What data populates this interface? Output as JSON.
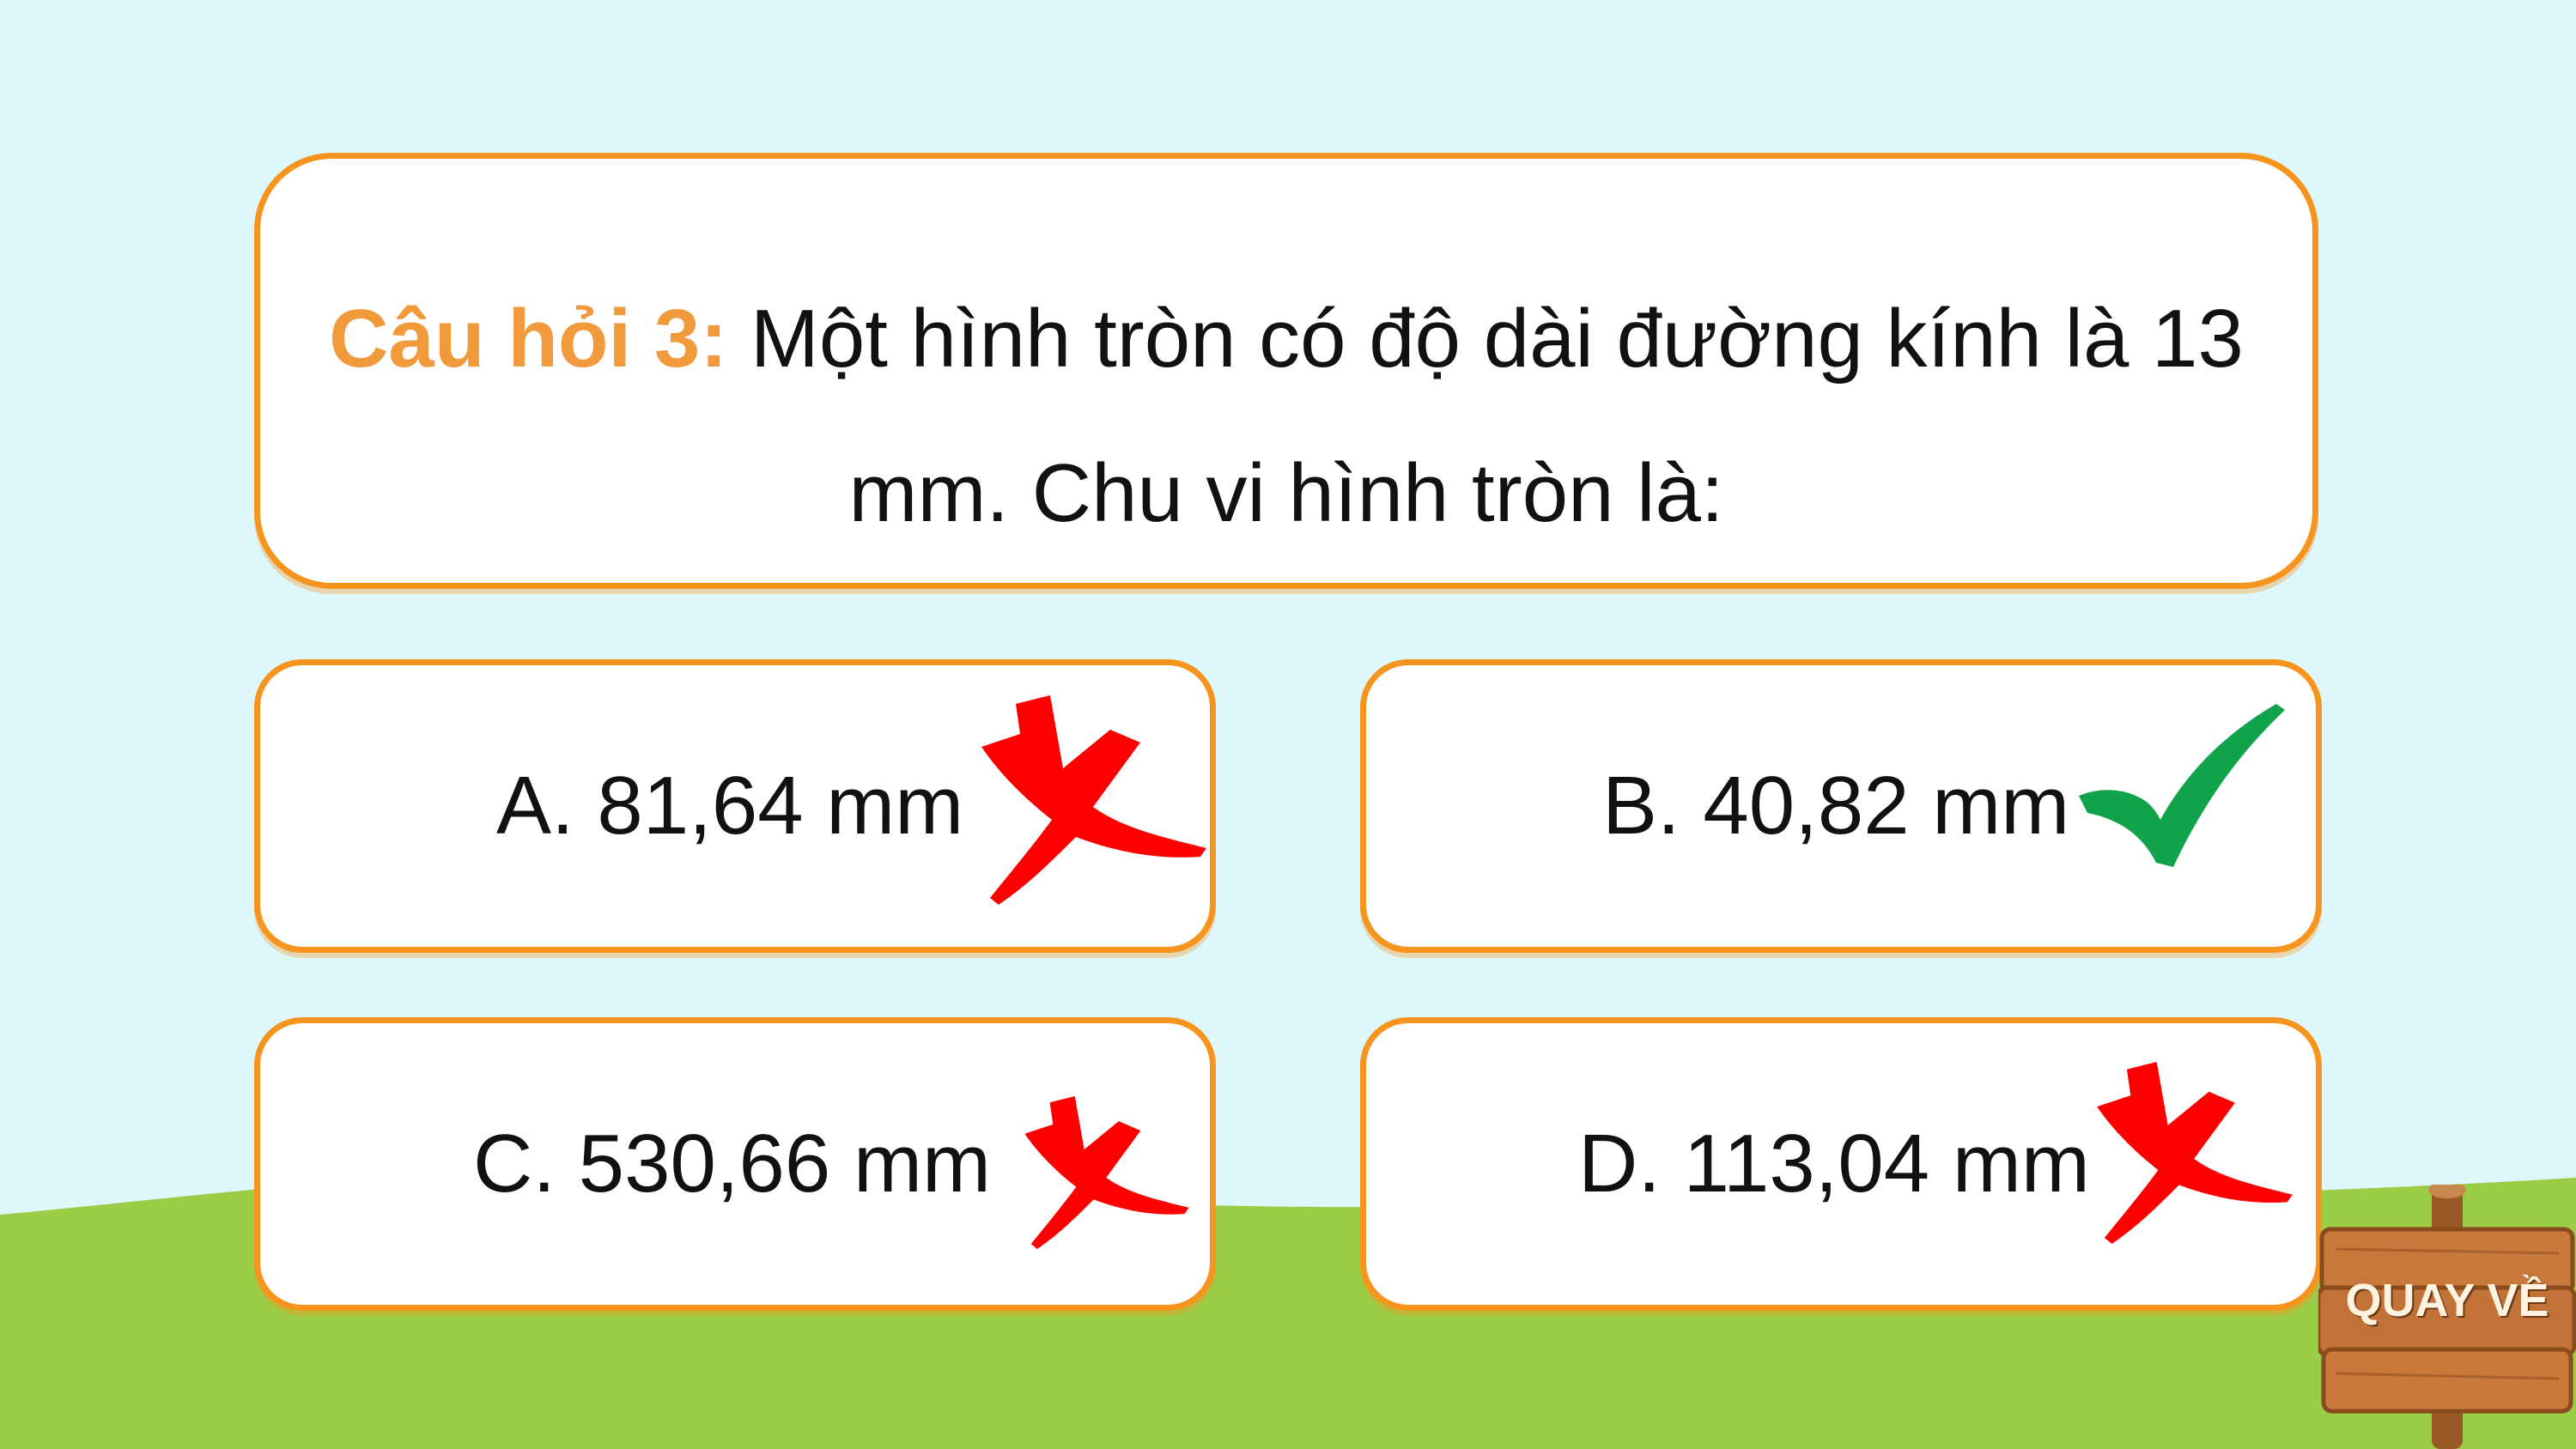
{
  "question": {
    "label": "Câu hỏi 3:",
    "text": "Một hình tròn có độ dài đường kính là 13 mm. Chu vi hình tròn là:"
  },
  "answers": [
    {
      "text": "A. 81,64 mm",
      "mark": "cross-icon"
    },
    {
      "text": "B. 40,82 mm",
      "mark": "check-icon"
    },
    {
      "text": "C. 530,66 mm",
      "mark": "cross-icon"
    },
    {
      "text": "D. 113,04 mm",
      "mark": "cross-icon"
    }
  ],
  "back_button": {
    "label": "QUAY VỀ"
  },
  "colors": {
    "sky": "#ddf7fb",
    "grass": "#9bcc45",
    "card_border": "#f7941d",
    "question_label": "#f09a3c",
    "cross": "#ff0000",
    "check": "#10a34a",
    "wood": "#c8783a"
  }
}
